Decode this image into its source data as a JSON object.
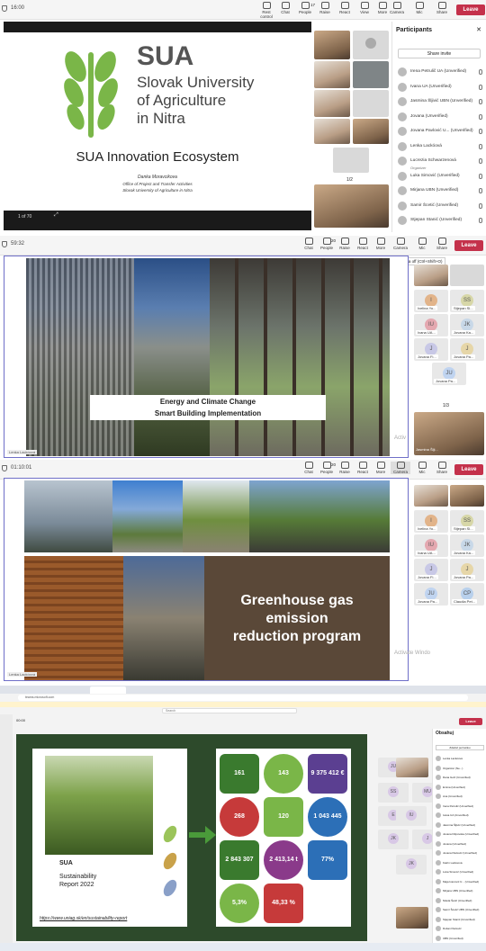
{
  "panel1": {
    "time": "16:00",
    "toolbar": [
      "Rest control",
      "Chat",
      "People",
      "Raise",
      "React",
      "View",
      "More",
      "Camera",
      "Mic",
      "Share"
    ],
    "people_count": "17",
    "leave": "Leave",
    "slide": {
      "brand": "SUA",
      "org_line1": "Slovak University",
      "org_line2": "of Agriculture",
      "org_line3": "in Nitra",
      "title": "SUA Innovation Ecosystem",
      "author": "Danka Moravcikova",
      "office": "Office of Project and Transfer Activities",
      "org_full": "Slovak University of Agriculture in Nitra",
      "page": "1 of 70"
    },
    "pager": "1/2",
    "participants_title": "Participants",
    "share_invite": "Share invite",
    "participants": [
      {
        "name": "Irena Petrulič UA (Unverified)"
      },
      {
        "name": "Ivana UA (Unverified)"
      },
      {
        "name": "Jasmina Šljivić UBN (Unverified)"
      },
      {
        "name": "Jovana (Unverified)"
      },
      {
        "name": "Jovana Pavlović U... (Unverified)"
      },
      {
        "name": "Lenka Lackóová"
      },
      {
        "name": "Lucrezia Schwarzenová",
        "sub": "Organizer"
      },
      {
        "name": "Luka Simović (Unverified)"
      },
      {
        "name": "Mirjana UBN (Unverified)"
      },
      {
        "name": "Samir Šcetić (Unverified)"
      },
      {
        "name": "Stjepan Stanić (Unverified)"
      }
    ]
  },
  "panel2": {
    "time": "59:32",
    "people_count": "20",
    "toolbar": [
      "Chat",
      "People",
      "Raise",
      "React",
      "View",
      "More",
      "Camera",
      "Mic",
      "Share"
    ],
    "leave": "Leave",
    "tooltip": "Turn camera off (Ctrl+Shift+O)",
    "slide_line1": "Energy and Climate Change",
    "slide_line2": "Smart Building Implementation",
    "presenter": "Lenka Lackóová",
    "grid": [
      {
        "ini": "I",
        "nm": "Ivelina Yo..."
      },
      {
        "ini": "SS",
        "nm": "Stjepan Sl..."
      },
      {
        "ini": "IU",
        "nm": "Ivana UA..."
      },
      {
        "ini": "JK",
        "nm": "Jovana Ka..."
      },
      {
        "ini": "J",
        "nm": "Jovana Fi..."
      },
      {
        "ini": "J",
        "nm": "Jovana Pa..."
      },
      {
        "ini": "JU",
        "nm": "Jovana Pa..."
      }
    ],
    "pager": "1/3",
    "watermark": "Activ",
    "self_name": "Jasmina Šlji..."
  },
  "panel3": {
    "time": "01:10:01",
    "people_count": "20",
    "toolbar": [
      "Chat",
      "People",
      "Raise",
      "React",
      "View",
      "More",
      "Camera",
      "Mic",
      "Share"
    ],
    "leave": "Leave",
    "slide_line1": "Greenhouse gas",
    "slide_line2": "emission",
    "slide_line3": "reduction program",
    "presenter": "Lenka Lackóová",
    "grid": [
      {
        "ini": "I",
        "nm": "Ivelina Yo..."
      },
      {
        "ini": "SS",
        "nm": "Stjepan Sl..."
      },
      {
        "ini": "IU",
        "nm": "Ivana UA..."
      },
      {
        "ini": "JK",
        "nm": "Jovana Ka..."
      },
      {
        "ini": "J",
        "nm": "Jovana Fi..."
      },
      {
        "ini": "J",
        "nm": "Jovana Pa..."
      },
      {
        "ini": "JU",
        "nm": "Jovana Pa..."
      },
      {
        "ini": "CP",
        "nm": "Claudia Pet..."
      }
    ],
    "watermark": "Activate Windo"
  },
  "panel4": {
    "address": "teams.microsoft.com",
    "search": "Search",
    "time": "00:00",
    "leave": "Leave",
    "participants_title": "Obsahuj",
    "share": "Zdieľať pozvánku",
    "report_title": "Sustainability Report 2022",
    "url": "https://www.uniag.sk/en/sustainability-report",
    "brand": "SUA",
    "stats": [
      "161",
      "143",
      "9 375 412 €",
      "268",
      "120",
      "1 043 445 kWh",
      "2 843 307 kWh",
      "2 413,14 t",
      "77%",
      "5,3%",
      "48,33 %"
    ],
    "grid_initials": [
      "JU",
      "SS",
      "MU",
      "E",
      "IU",
      "JK",
      "J",
      "JK"
    ],
    "plist": [
      "Lenka Lackóová",
      "Organizer (Ne...)",
      "Dana Gočí (Unverified)",
      "Emina (Unverified)",
      "Ana (Unverified)",
      "Irena Petrulić (Unverified)",
      "Ivana UA (Unverified)",
      "Jasmina Šljivić (Unverified)",
      "Jovana Filipovska (Unverified)",
      "Jovana (Unverified)",
      "Jovana Pavlović (Unverified)",
      "Katrin Lackóová",
      "Luka Simović (Unverified)",
      "Maja Ivanović U... (Unverified)",
      "Mirjana UBN (Unverified)",
      "Nikola Šarić (Unverified)",
      "Samir Šcetić UBN (Unverified)",
      "Stjepan Stanić (Unverified)",
      "Dušan Pavlović",
      "UBN (Unverified)"
    ]
  }
}
